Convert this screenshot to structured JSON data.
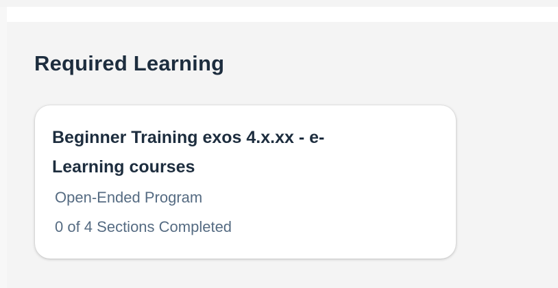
{
  "section": {
    "title": "Required Learning"
  },
  "card": {
    "title": "Beginner Training exos 4.x.xx - e-Learning courses",
    "type": "Open-Ended Program",
    "progress": "0 of 4 Sections Completed"
  }
}
